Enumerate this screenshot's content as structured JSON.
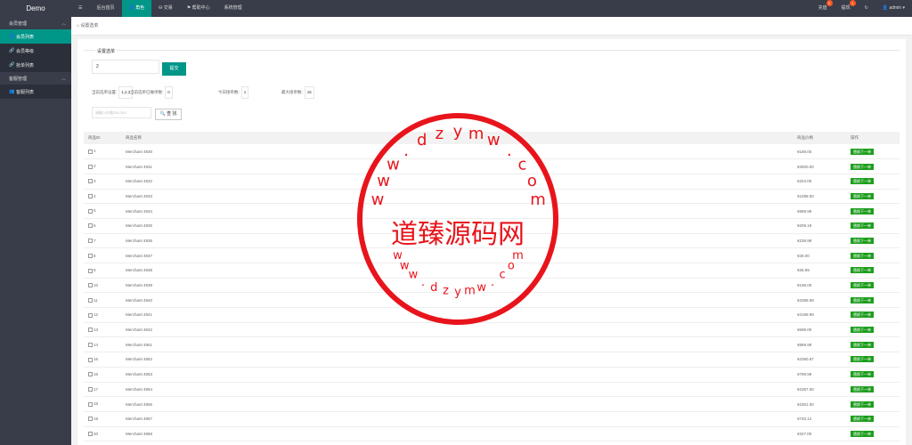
{
  "app": {
    "title": "Demo"
  },
  "sidebar": {
    "groups": [
      {
        "label": "会员管理",
        "items": [
          {
            "label": "会员列表",
            "active": true
          },
          {
            "label": "会员等级",
            "active": false
          },
          {
            "label": "抢单列表",
            "active": false
          }
        ]
      },
      {
        "label": "客服管理",
        "items": [
          {
            "label": "客服列表",
            "active": false
          }
        ]
      }
    ]
  },
  "topbar": {
    "menu_icon": "☰",
    "nav": [
      "后台首页",
      "角色",
      "交易",
      "帮助中心",
      "系统管理"
    ],
    "active_index": 1,
    "recharge": {
      "label": "充值",
      "badge": "0"
    },
    "withdraw": {
      "label": "提现",
      "badge": "1"
    },
    "refresh_icon": "↻",
    "user": "admin"
  },
  "breadcrumb": "设置选单",
  "form": {
    "section_title": "设置选单",
    "input_value": "2",
    "submit_label": "提交",
    "stats": [
      {
        "label": "当前选单设置:",
        "value": "1,2,3"
      },
      {
        "label": "当前选单已做单数:",
        "value": "0"
      },
      {
        "label": "今日接单数:",
        "value": "1"
      },
      {
        "label": "最大接单数:",
        "value": "15"
      }
    ],
    "price_placeholder": "请输入价格200-300",
    "query_label": "查 找"
  },
  "table": {
    "headers": [
      "商品ID",
      "商品名称",
      "",
      "商品价格",
      "操作"
    ],
    "action_label": "替换下一单",
    "rows": [
      {
        "id": "1",
        "name": "Merchant 4930",
        "price": "¥188.00"
      },
      {
        "id": "2",
        "name": "Merchant 4931",
        "price": "¥2500.00"
      },
      {
        "id": "3",
        "name": "Merchant 4932",
        "price": "¥204.00"
      },
      {
        "id": "4",
        "name": "Merchant 4933",
        "price": "¥1099.00"
      },
      {
        "id": "5",
        "name": "Merchant 4934",
        "price": "¥899.99"
      },
      {
        "id": "6",
        "name": "Merchant 4935",
        "price": "¥209.19"
      },
      {
        "id": "7",
        "name": "Merchant 4936",
        "price": "¥239.99"
      },
      {
        "id": "8",
        "name": "Merchant 4937",
        "price": "¥28.00"
      },
      {
        "id": "9",
        "name": "Merchant 4938",
        "price": "¥28.99"
      },
      {
        "id": "10",
        "name": "Merchant 4939",
        "price": "¥198.00"
      },
      {
        "id": "11",
        "name": "Merchant 4940",
        "price": "¥2399.99"
      },
      {
        "id": "12",
        "name": "Merchant 4941",
        "price": "¥4199.99"
      },
      {
        "id": "13",
        "name": "Merchant 4942",
        "price": "¥699.00"
      },
      {
        "id": "14",
        "name": "Merchant 4951",
        "price": "¥899.99"
      },
      {
        "id": "15",
        "name": "Merchant 4952",
        "price": "¥2390.87"
      },
      {
        "id": "16",
        "name": "Merchant 4953",
        "price": "¥799.99"
      },
      {
        "id": "17",
        "name": "Merchant 4954",
        "price": "¥2267.00"
      },
      {
        "id": "18",
        "name": "Merchant 4955",
        "price": "¥2301.00"
      },
      {
        "id": "19",
        "name": "Merchant 4957",
        "price": "¥740.12"
      },
      {
        "id": "20",
        "name": "Merchant 4958",
        "price": "¥347.00"
      }
    ]
  },
  "watermark": {
    "center_text": "道臻源码网",
    "top_arc": "www.dzymw.com",
    "bottom_arc": "www.dzymw.com",
    "color": "#e8141c"
  }
}
